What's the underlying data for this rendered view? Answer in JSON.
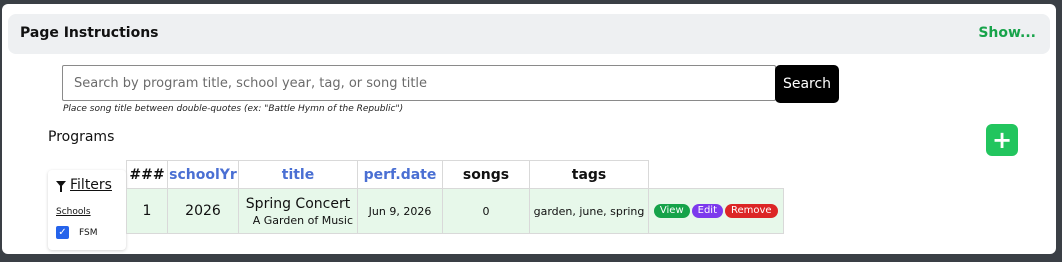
{
  "instructions": {
    "title": "Page Instructions",
    "show_label": "Show..."
  },
  "search": {
    "placeholder": "Search by program title, school year, tag, or song title",
    "value": "",
    "button_label": "Search",
    "hint": "Place song title between double-quotes (ex: \"Battle Hymn of the Republic\")"
  },
  "programs": {
    "heading": "Programs",
    "add_label": "+"
  },
  "filters": {
    "title": "Filters",
    "schools_label": "Schools",
    "schools": [
      {
        "label": "FSM",
        "checked": true
      }
    ]
  },
  "table": {
    "columns": [
      "###",
      "schoolYr",
      "title",
      "perf.date",
      "songs",
      "tags"
    ],
    "rows": [
      {
        "num": "1",
        "school_year": "2026",
        "title": "Spring Concert",
        "subtitle": "A Garden of Music",
        "perf_date": "Jun 9, 2026",
        "songs": "0",
        "tags": "garden, june, spring",
        "actions": {
          "view": "View",
          "edit": "Edit",
          "remove": "Remove"
        }
      }
    ]
  },
  "colors": {
    "accent_green": "#17a34a",
    "add_green": "#22c55e",
    "sort_blue": "#4a6fd3",
    "row_bg": "#e7f8ea",
    "view": "#16a34a",
    "edit": "#7c3aed",
    "remove": "#dc2626"
  }
}
